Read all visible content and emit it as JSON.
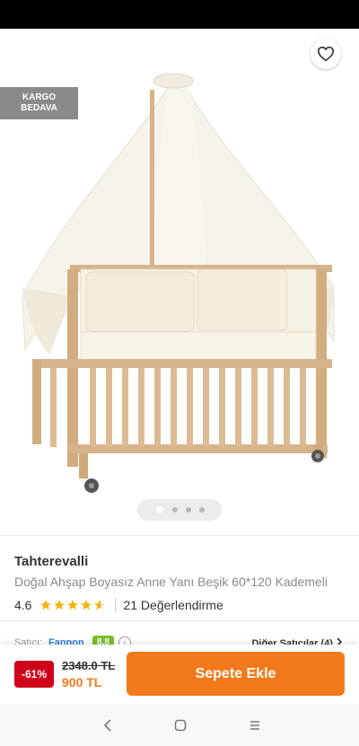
{
  "badge": {
    "line1": "KARGO",
    "line2": "BEDAVA"
  },
  "icons": {
    "back": "arrow-left-icon",
    "share": "share-icon",
    "favorite": "heart-outline-icon",
    "star": "star-icon",
    "info": "info-icon",
    "chevron": "chevron-right-icon",
    "nav_back": "nav-back-icon",
    "nav_home": "nav-home-icon",
    "nav_recents": "nav-recents-icon"
  },
  "gallery": {
    "image_count": 4,
    "active_index": 0
  },
  "product": {
    "brand": "Tahterevalli",
    "name": "Doğal Ahşap Boyasız Anne Yanı Beşik 60*120 Kademeli",
    "rating": "4.6",
    "rating_value": 4.6,
    "review_count": "21 Değerlendirme"
  },
  "seller": {
    "label": "Satıcı:",
    "name": "Fanpon",
    "score": "8.8",
    "info_glyph": "i",
    "other_sellers": "Diğer Satıcılar (4)"
  },
  "pricing": {
    "discount": "-61%",
    "old_price": "2348.0 TL",
    "new_price": "900 TL"
  },
  "cart": {
    "label": "Sepete Ekle"
  },
  "colors": {
    "accent": "#f27a1a",
    "discount_red": "#d0021b",
    "star": "#f4b400",
    "seller_link": "#2d7fd6",
    "score_green": "#7cbf2c"
  }
}
